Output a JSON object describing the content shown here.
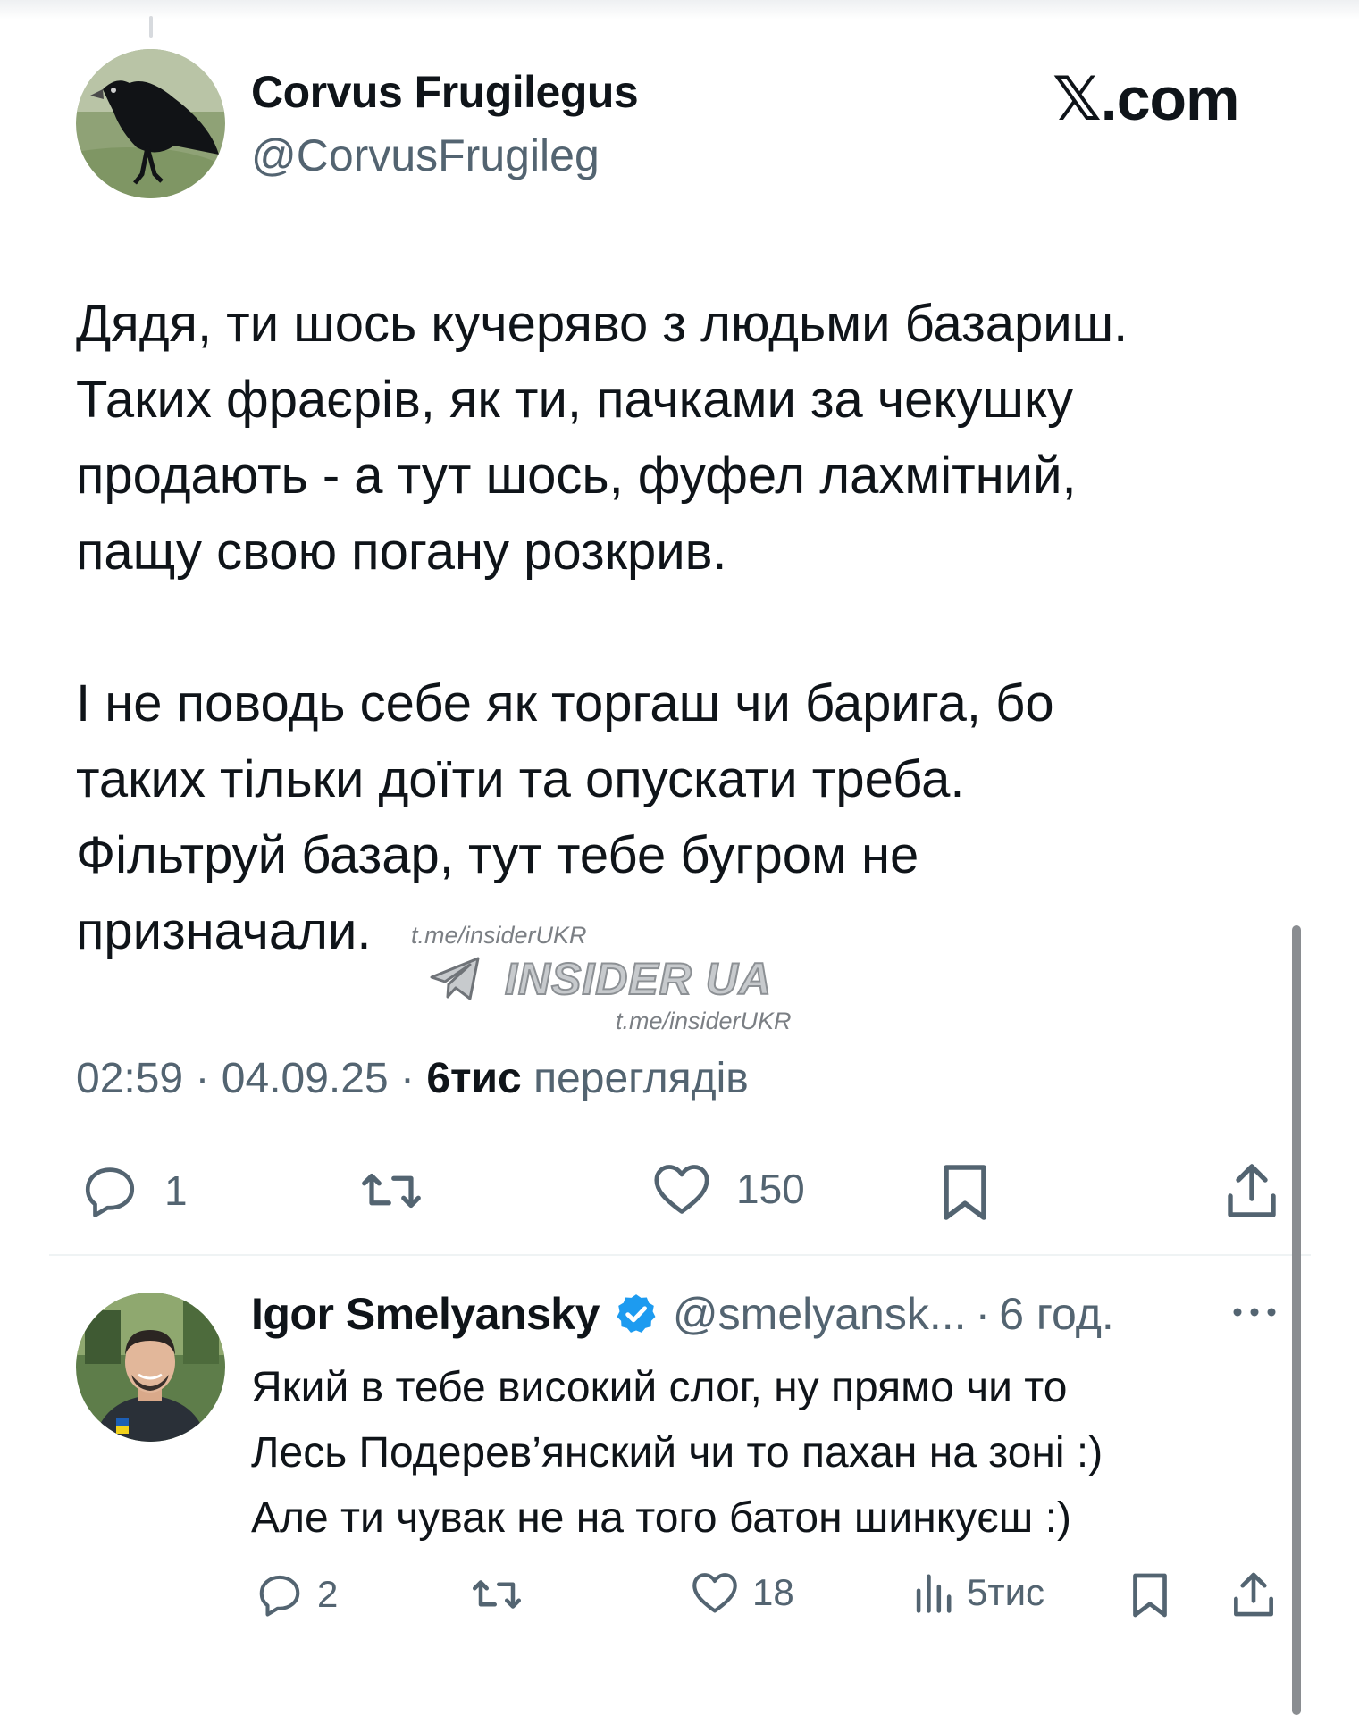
{
  "brand": {
    "logo_mark": "𝕏",
    "logo_text": ".com"
  },
  "tweet": {
    "author_name": "Corvus Frugilegus",
    "author_handle": "@CorvusFrugileg",
    "avatar_icon": "rook-bird-avatar",
    "body_lines": [
      "Дядя, ти шось кучеряво з людьми базариш.",
      "Таких фраєрів, як ти, пачками за чекушку",
      "продають - а тут шось, фуфел лахмітний,",
      "пащу свою погану розкрив.",
      "І не поводь себе як торгаш чи барига, бо",
      "таких тільки доїти та опускати треба.",
      "Фільтруй базар, тут тебе бугром не",
      "призначали."
    ],
    "time": "02:59",
    "date": "04.09.25",
    "separator": "·",
    "views_count": "6тис",
    "views_label": "переглядів",
    "replies": "1",
    "likes": "150"
  },
  "watermark": {
    "small_url_1": "t.me/insiderUKR",
    "title": "INSIDER UA",
    "small_url_2": "t.me/insiderUKR"
  },
  "reply": {
    "author_name": "Igor Smelyansky",
    "author_handle": "@smelyansk...",
    "separator": "·",
    "time": "6 год.",
    "body_lines": [
      "Який в тебе високий слог, ну прямо чи то",
      "Лесь Подерев’янский чи то пахан на зоні :)",
      "Але ти чувак не на того батон шинкуєш :)"
    ],
    "replies": "2",
    "likes": "18",
    "views": "5тис"
  },
  "colors": {
    "text": "#0f1419",
    "secondary": "#536471",
    "verified_blue": "#1d9bf0",
    "divider": "#eff3f4"
  }
}
